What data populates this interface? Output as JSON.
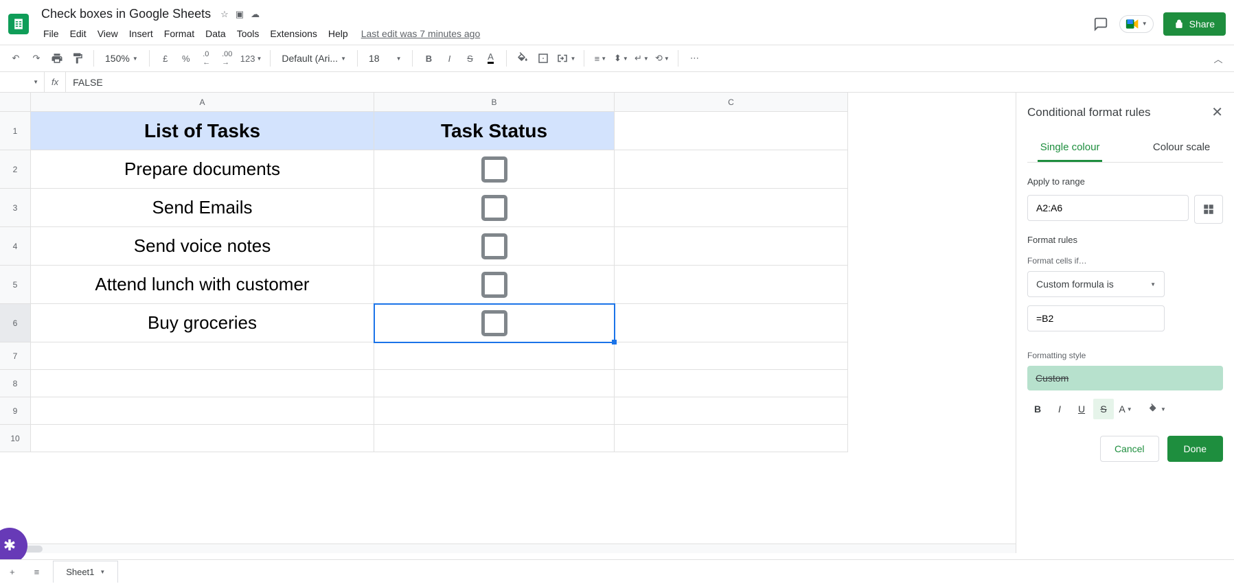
{
  "doc": {
    "title": "Check boxes in Google Sheets",
    "last_edit": "Last edit was 7 minutes ago"
  },
  "menu": {
    "file": "File",
    "edit": "Edit",
    "view": "View",
    "insert": "Insert",
    "format": "Format",
    "data": "Data",
    "tools": "Tools",
    "extensions": "Extensions",
    "help": "Help"
  },
  "share": {
    "label": "Share"
  },
  "toolbar": {
    "zoom": "150%",
    "currency": "£",
    "percent": "%",
    "dec_dec": ".0",
    "dec_inc": ".00",
    "numfmt": "123",
    "font": "Default (Ari...",
    "size": "18"
  },
  "formula_bar": {
    "value": "FALSE"
  },
  "columns": [
    "A",
    "B",
    "C"
  ],
  "rows": [
    "1",
    "2",
    "3",
    "4",
    "5",
    "6",
    "7",
    "8",
    "9",
    "10"
  ],
  "cells": {
    "headerA": "List of Tasks",
    "headerB": "Task Status",
    "a2": "Prepare documents",
    "a3": "Send Emails",
    "a4": "Send voice notes",
    "a5": "Attend lunch with customer",
    "a6": "Buy groceries"
  },
  "sidebar": {
    "title": "Conditional format rules",
    "tab_single": "Single colour",
    "tab_scale": "Colour scale",
    "apply_label": "Apply to range",
    "range": "A2:A6",
    "rules_label": "Format rules",
    "cells_if": "Format cells if…",
    "rule": "Custom formula is",
    "formula": "=B2",
    "style_label": "Formatting style",
    "style_name": "Custom",
    "cancel": "Cancel",
    "done": "Done"
  },
  "sheet_tab": {
    "name": "Sheet1"
  }
}
